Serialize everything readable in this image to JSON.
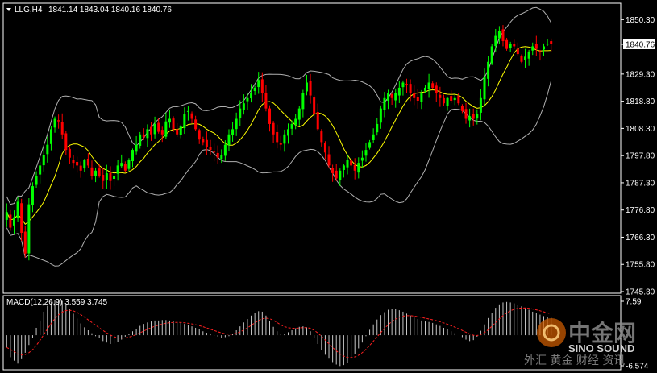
{
  "header": {
    "symbol": "LLG,H4",
    "ohlc": "1841.14 1843.04 1840.16 1840.76"
  },
  "macd_header": "MACD(12,26,9) 3.559 3.745",
  "watermark": {
    "cn": "中金网",
    "en": "SINO SOUND",
    "sub": "外汇 黄金 财经 资讯"
  },
  "colors": {
    "bull": "#00ff00",
    "bear": "#ff0000",
    "ma": "#ffff00",
    "bands": "#b0b0b0",
    "histogram": "#c8c8c8",
    "signal": "#ff2020",
    "frame": "#ffffff"
  },
  "chart_data": [
    {
      "type": "candlestick",
      "symbol": "LLG",
      "timeframe": "H4",
      "ylim": [
        1745.3,
        1856.0
      ],
      "y_ticks": [
        "1850.30",
        "1840.76",
        "1829.30",
        "1818.80",
        "1808.30",
        "1797.80",
        "1787.30",
        "1776.80",
        "1766.30",
        "1755.80",
        "1745.30"
      ],
      "current_price": "1840.76",
      "indicators": [
        "Bollinger Bands (upper, lower)",
        "Moving Average"
      ],
      "closes": [
        1776,
        1770,
        1774,
        1780,
        1768,
        1760,
        1779,
        1786,
        1790,
        1794,
        1798,
        1802,
        1808,
        1812,
        1811,
        1806,
        1800,
        1797,
        1795,
        1794,
        1792,
        1796,
        1794,
        1790,
        1792,
        1790,
        1788,
        1791,
        1788,
        1790,
        1794,
        1795,
        1792,
        1796,
        1800,
        1802,
        1806,
        1805,
        1808,
        1806,
        1810,
        1807,
        1806,
        1811,
        1812,
        1808,
        1806,
        1809,
        1814,
        1815,
        1812,
        1808,
        1804,
        1803,
        1801,
        1800,
        1799,
        1797,
        1798,
        1802,
        1806,
        1808,
        1812,
        1816,
        1818,
        1820,
        1822,
        1824,
        1827,
        1822,
        1816,
        1810,
        1806,
        1803,
        1802,
        1806,
        1808,
        1810,
        1812,
        1816,
        1822,
        1826,
        1821,
        1814,
        1808,
        1803,
        1799,
        1794,
        1791,
        1789,
        1792,
        1794,
        1796,
        1794,
        1792,
        1795,
        1797,
        1800,
        1803,
        1806,
        1810,
        1816,
        1820,
        1822,
        1820,
        1822,
        1824,
        1826,
        1825,
        1822,
        1820,
        1819,
        1822,
        1824,
        1826,
        1824,
        1822,
        1820,
        1818,
        1820,
        1819,
        1820,
        1818,
        1815,
        1812,
        1813,
        1812,
        1814,
        1820,
        1828,
        1834,
        1840,
        1844,
        1846,
        1842,
        1839,
        1841,
        1840,
        1837,
        1834,
        1836,
        1838,
        1840,
        1839,
        1838,
        1840,
        1841,
        1840.76
      ],
      "ma_period": 10,
      "bb_period": 20,
      "bb_width": 2
    },
    {
      "type": "bar",
      "name": "MACD(12,26,9)",
      "main": 3.559,
      "signal": 3.745,
      "ylim": [
        -6.574,
        7.59
      ],
      "y_ticks": [
        "7.59",
        "-6.574"
      ],
      "histogram": [
        -2.5,
        -4.5,
        -5.2,
        -5.8,
        -4.9,
        -3.6,
        -2.0,
        -0.5,
        1.5,
        3.0,
        4.8,
        6.0,
        6.8,
        7.2,
        7.3,
        7.0,
        6.3,
        5.4,
        4.4,
        3.4,
        2.4,
        1.6,
        1.0,
        0.4,
        -0.2,
        -0.6,
        -1.2,
        -1.5,
        -1.8,
        -1.7,
        -1.4,
        -0.9,
        -0.3,
        0.2,
        0.8,
        1.3,
        1.9,
        2.3,
        2.6,
        2.8,
        3.0,
        3.0,
        3.1,
        3.1,
        3.0,
        2.8,
        2.7,
        2.5,
        2.3,
        2.0,
        1.8,
        1.5,
        1.2,
        0.8,
        0.5,
        0.2,
        -0.1,
        -0.3,
        -0.5,
        -0.4,
        -0.2,
        0.3,
        1.0,
        1.8,
        2.6,
        3.3,
        4.0,
        4.6,
        4.9,
        4.8,
        4.0,
        2.9,
        1.7,
        0.8,
        0.2,
        0.3,
        0.6,
        1.0,
        1.4,
        1.7,
        1.8,
        1.6,
        0.8,
        -0.5,
        -1.8,
        -3.0,
        -4.0,
        -4.8,
        -5.5,
        -6.0,
        -6.3,
        -6.1,
        -5.6,
        -4.8,
        -3.8,
        -2.7,
        -1.5,
        -0.2,
        1.1,
        2.2,
        3.2,
        4.1,
        4.7,
        5.2,
        5.4,
        5.3,
        5.1,
        4.8,
        4.4,
        4.0,
        3.6,
        3.3,
        3.0,
        2.8,
        2.7,
        2.5,
        2.2,
        1.9,
        1.5,
        1.2,
        0.8,
        0.4,
        0.0,
        -0.4,
        -0.9,
        -1.2,
        -1.0,
        -0.3,
        0.9,
        2.2,
        3.5,
        4.6,
        5.6,
        6.3,
        6.7,
        6.8,
        6.7,
        6.5,
        6.2,
        5.9,
        5.6,
        5.2,
        4.8,
        4.5,
        4.2,
        3.9,
        3.7,
        3.559
      ]
    }
  ]
}
